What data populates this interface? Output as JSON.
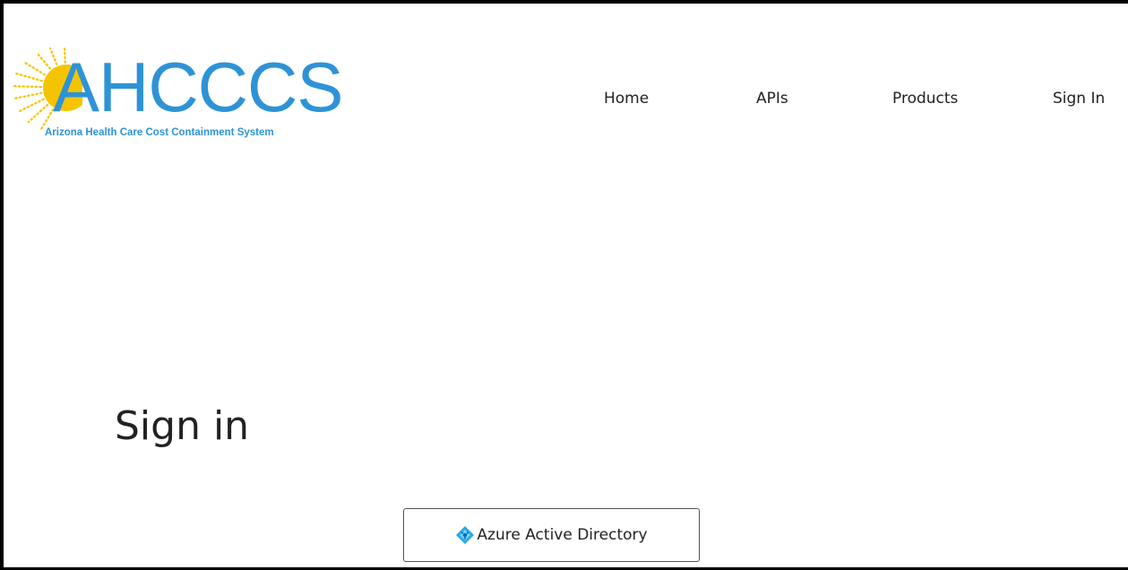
{
  "logo": {
    "name": "AHCCCS",
    "tagline": "Arizona Health Care Cost Containment System",
    "colors": {
      "text": "#2e93d6",
      "sun": "#f5c400"
    }
  },
  "nav": {
    "items": [
      {
        "label": "Home"
      },
      {
        "label": "APIs"
      },
      {
        "label": "Products"
      },
      {
        "label": "Sign In"
      }
    ]
  },
  "page": {
    "title": "Sign in"
  },
  "providers": {
    "aad": {
      "label": "Azure Active Directory",
      "icon": "azure-ad-icon"
    }
  }
}
